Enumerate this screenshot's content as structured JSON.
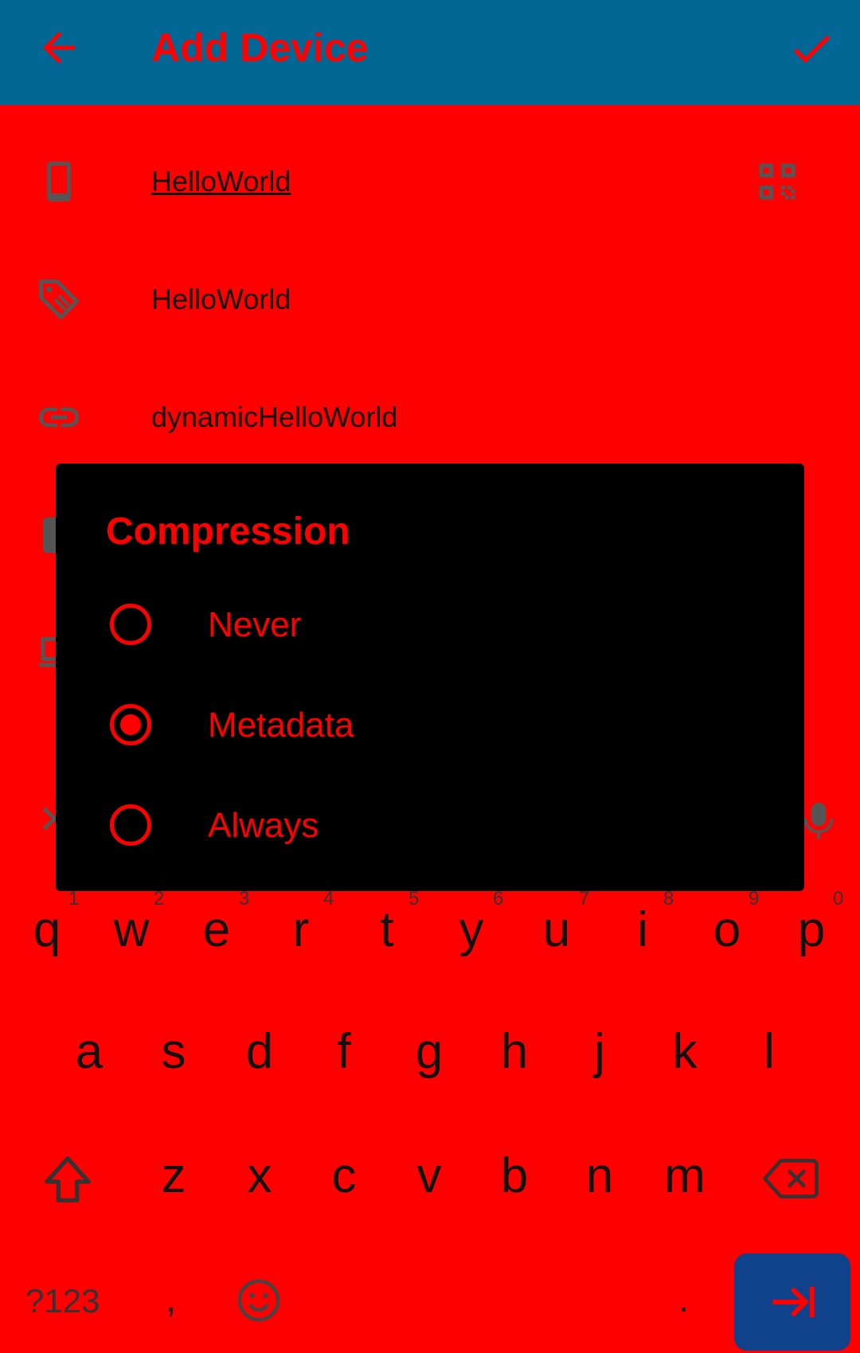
{
  "app_bar": {
    "title": "Add Device",
    "back_icon": "arrow-back-icon",
    "confirm_icon": "check-icon",
    "background": "#036796",
    "title_color": "#ff0000"
  },
  "form": {
    "device_id": {
      "value": "HelloWorld",
      "icon": "phone-icon",
      "action_icon": "qr-code-icon"
    },
    "device_name": {
      "value": "HelloWorld",
      "icon": "tag-icon"
    },
    "addresses": {
      "value": "dynamicHelloWorld",
      "icon": "link-icon"
    }
  },
  "dialog": {
    "title": "Compression",
    "options": [
      {
        "label": "Never",
        "selected": false
      },
      {
        "label": "Metadata",
        "selected": true
      },
      {
        "label": "Always",
        "selected": false
      }
    ],
    "accent": "#ff0000",
    "background": "#000000"
  },
  "keyboard": {
    "number_hints": [
      "1",
      "2",
      "3",
      "4",
      "5",
      "6",
      "7",
      "8",
      "9",
      "0"
    ],
    "row1": [
      "q",
      "w",
      "e",
      "r",
      "t",
      "y",
      "u",
      "i",
      "o",
      "p"
    ],
    "row2": [
      "a",
      "s",
      "d",
      "f",
      "g",
      "h",
      "j",
      "k",
      "l"
    ],
    "row3": [
      "z",
      "x",
      "c",
      "v",
      "b",
      "n",
      "m"
    ],
    "symbols_label": "?123",
    "comma": ",",
    "period": ".",
    "enter_color": "#0f428a"
  }
}
